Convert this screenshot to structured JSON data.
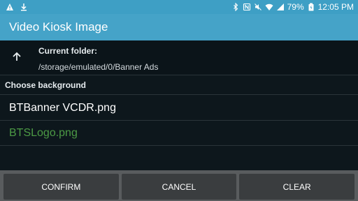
{
  "status_bar": {
    "left_icons": [
      "warning-icon",
      "download-icon"
    ],
    "right_icons": [
      "bluetooth-icon",
      "nfc-icon",
      "mute-icon",
      "wifi-icon",
      "signal-icon",
      "battery-icon"
    ],
    "battery_percent": "79%",
    "time": "12:05 PM"
  },
  "app_bar": {
    "title": "Video Kiosk Image"
  },
  "folder": {
    "label": "Current folder:",
    "path": "/storage/emulated/0/Banner Ads",
    "up_icon": "arrow-up-icon"
  },
  "list": {
    "header": "Choose background",
    "items": [
      {
        "label": "BTBanner VCDR.png",
        "color": "#ffffff"
      },
      {
        "label": "BTSLogo.png",
        "color": "#4c9a45"
      }
    ]
  },
  "buttons": {
    "confirm": "CONFIRM",
    "cancel": "CANCEL",
    "clear": "CLEAR"
  },
  "colors": {
    "status_bar": "#3e9fc5",
    "app_bar": "#45a3c8",
    "background": "#0d171c",
    "button_bar": "#595c5e",
    "button": "#3a3d3f",
    "selected_text": "#4c9a45"
  }
}
